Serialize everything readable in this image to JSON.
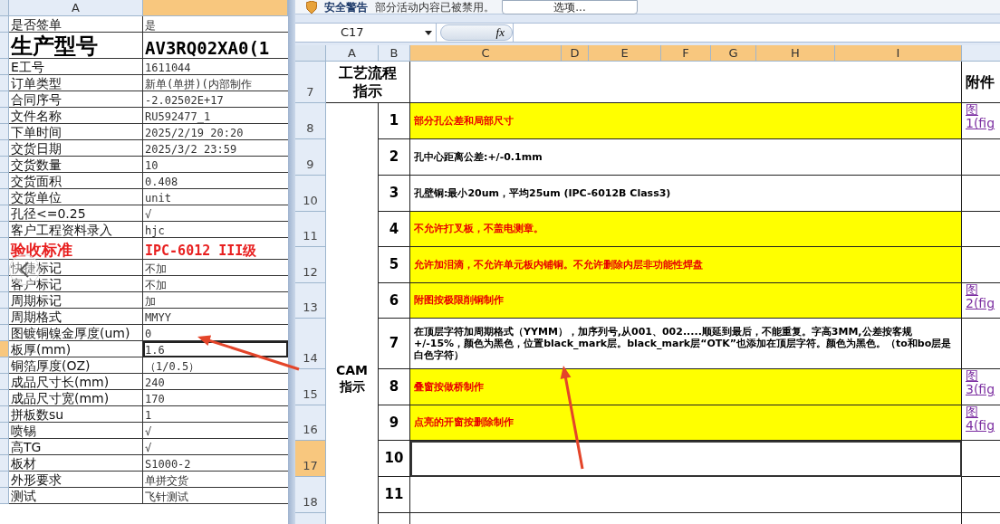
{
  "left_sheet": {
    "columns": [
      {
        "label": "A",
        "selected": false
      },
      {
        "selected": true
      }
    ],
    "rows": [
      {
        "label": "是否签单",
        "value": "是",
        "kind": "normal",
        "selected": false
      },
      {
        "label": "生产型号",
        "value": "AV3RQ02XA0(1",
        "kind": "title",
        "selected": false
      },
      {
        "label": "E工号",
        "value": "1611044",
        "kind": "normal",
        "selected": false
      },
      {
        "label": "订单类型",
        "value": "新单(单拼)(内部制作",
        "kind": "normal",
        "selected": false
      },
      {
        "label": "合同序号",
        "value": "-2.02502E+17",
        "kind": "normal",
        "selected": false
      },
      {
        "label": "文件名称",
        "value": "RU592477_1",
        "kind": "normal",
        "selected": false
      },
      {
        "label": "下单时间",
        "value": "2025/2/19 20:20",
        "kind": "normal",
        "selected": false
      },
      {
        "label": "交货日期",
        "value": "2025/3/2 23:59",
        "kind": "normal",
        "selected": false
      },
      {
        "label": "交货数量",
        "value": "10",
        "kind": "normal",
        "selected": false
      },
      {
        "label": "交货面积",
        "value": "0.408",
        "kind": "normal",
        "selected": false
      },
      {
        "label": "交货单位",
        "value": "unit",
        "kind": "normal",
        "selected": false
      },
      {
        "label": "孔径<=0.25",
        "value": "√",
        "kind": "normal",
        "selected": false
      },
      {
        "label": "客户工程资料录入",
        "value": "hjc",
        "kind": "normal",
        "selected": false
      },
      {
        "label": "验收标准",
        "value": "IPC-6012 III级",
        "kind": "standard",
        "selected": false
      },
      {
        "label": "快捷标记",
        "value": "不加",
        "kind": "normal",
        "selected": false
      },
      {
        "label": "客户标记",
        "value": "不加",
        "kind": "normal",
        "selected": false
      },
      {
        "label": "周期标记",
        "value": "加",
        "kind": "normal",
        "selected": false
      },
      {
        "label": "周期格式",
        "value": "MMYY",
        "kind": "normal",
        "selected": false
      },
      {
        "label": "图镀铜镍金厚度(um)",
        "value": "0",
        "kind": "normal",
        "selected": false
      },
      {
        "label": "板厚(mm)",
        "value": "1.6",
        "kind": "normal",
        "selected": true
      },
      {
        "label": "铜箔厚度(OZ)",
        "value": "（1/0.5）",
        "kind": "normal",
        "selected": false
      },
      {
        "label": "成品尺寸长(mm)",
        "value": "240",
        "kind": "normal",
        "selected": false
      },
      {
        "label": "成品尺寸宽(mm)",
        "value": "170",
        "kind": "normal",
        "selected": false
      },
      {
        "label": "拼板数su",
        "value": "1",
        "kind": "normal",
        "selected": false
      },
      {
        "label": "喷锡",
        "value": "√",
        "kind": "normal",
        "selected": false
      },
      {
        "label": "高TG",
        "value": "√",
        "kind": "normal",
        "selected": false
      },
      {
        "label": "板材",
        "value": "S1000-2",
        "kind": "normal",
        "selected": false
      },
      {
        "label": "外形要求",
        "value": "单拼交货",
        "kind": "normal",
        "selected": false
      },
      {
        "label": "测试",
        "value": "飞针测试",
        "kind": "normal",
        "selected": false
      }
    ]
  },
  "right_window": {
    "security_bar": {
      "title": "安全警告",
      "message": "部分活动内容已被禁用。",
      "button": "选项..."
    },
    "name_box": "C17",
    "formula_label": "fx",
    "columns": [
      {
        "label": "A",
        "selected": false
      },
      {
        "label": "B",
        "selected": false
      },
      {
        "label": "C",
        "selected": true
      },
      {
        "label": "D",
        "selected": true
      },
      {
        "label": "E",
        "selected": true
      },
      {
        "label": "F",
        "selected": true
      },
      {
        "label": "G",
        "selected": true
      },
      {
        "label": "H",
        "selected": true
      },
      {
        "label": "I",
        "selected": true
      }
    ],
    "row_numbers": [
      {
        "label": "7",
        "selected": false
      },
      {
        "label": "8",
        "selected": false
      },
      {
        "label": "9",
        "selected": false
      },
      {
        "label": "10",
        "selected": false
      },
      {
        "label": "11",
        "selected": false
      },
      {
        "label": "12",
        "selected": false
      },
      {
        "label": "13",
        "selected": false
      },
      {
        "label": "14",
        "selected": false
      },
      {
        "label": "15",
        "selected": false
      },
      {
        "label": "16",
        "selected": false
      },
      {
        "label": "17",
        "selected": true
      },
      {
        "label": "18",
        "selected": false
      }
    ],
    "header_row": {
      "title": "工艺流程指示",
      "attachment": "附件"
    },
    "section_label": "CAM 指示",
    "steps": [
      {
        "number": "1",
        "text": "部分孔公差和局部尺寸",
        "highlight": true,
        "link": "图 1(fig",
        "selected": false
      },
      {
        "number": "2",
        "text": "孔中心距离公差:+/-0.1mm",
        "highlight": false,
        "selected": false
      },
      {
        "number": "3",
        "text": "孔壁铜:最小20um，平均25um (IPC-6012B Class3)",
        "highlight": false,
        "selected": false
      },
      {
        "number": "4",
        "text": "不允许打叉板，不盖电测章。",
        "highlight": true,
        "selected": false
      },
      {
        "number": "5",
        "text": "允许加泪滴，不允许单元板内铺铜。不允许删除内层非功能性焊盘",
        "highlight": true,
        "selected": false
      },
      {
        "number": "6",
        "text": "附图按极限削铜制作",
        "highlight": true,
        "link": "图 2(fig",
        "selected": false
      },
      {
        "number": "7",
        "text": "在顶层字符加周期格式（YYMM），加序列号,从001、002.....顺延到最后，不能重复。字高3MM,公差按客规+/-15%，颜色为黑色，位置black_mark层。black_mark层“OTK”也添加在顶层字符。颜色为黑色。（to和bo层是白色字符）",
        "highlight": false,
        "selected": false
      },
      {
        "number": "8",
        "text": "叠窗按做桥制作",
        "highlight": true,
        "link": "图 3(fig",
        "selected": false
      },
      {
        "number": "9",
        "text": "点亮的开窗按删除制作",
        "highlight": true,
        "link": "图 4(fig",
        "selected": false
      },
      {
        "number": "10",
        "highlight": false,
        "selected": true
      },
      {
        "number": "11",
        "highlight": false,
        "selected": false
      }
    ]
  }
}
